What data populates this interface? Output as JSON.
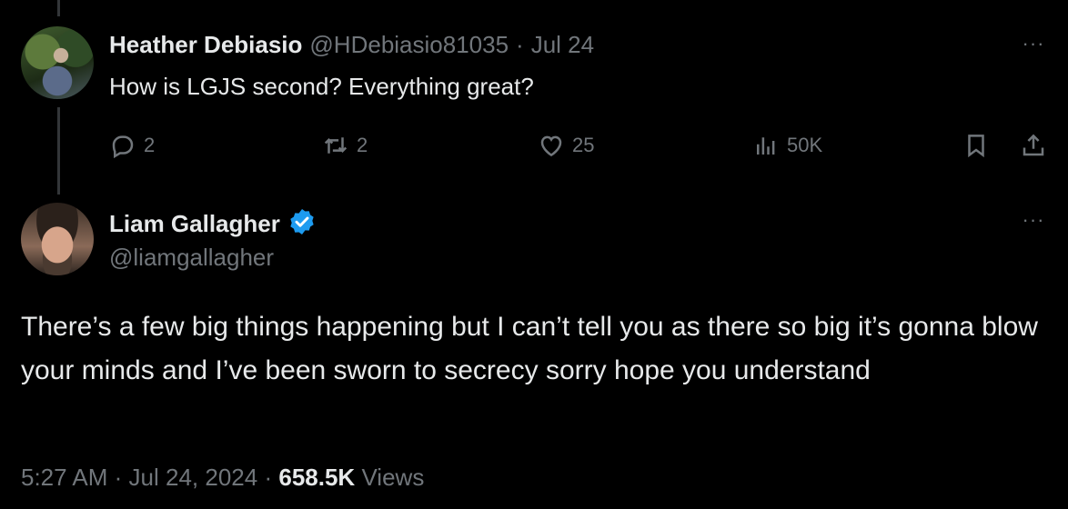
{
  "reply_tweet": {
    "display_name": "Heather Debiasio",
    "handle": "@HDebiasio81035",
    "separator": "·",
    "date": "Jul 24",
    "text": "How is LGJS second? Everything great?",
    "more": "···",
    "actions": {
      "replies": "2",
      "reposts": "2",
      "likes": "25",
      "views": "50K"
    }
  },
  "main_tweet": {
    "display_name": "Liam Gallagher",
    "handle": "@liamgallagher",
    "verified": true,
    "more": "···",
    "text": "There’s a few big things happening but I can’t tell you as there so big it’s gonna blow your minds and I’ve been sworn to secrecy sorry hope you understand",
    "time": "5:27 AM",
    "date": "Jul 24, 2024",
    "separator": "·",
    "views_count": "658.5K",
    "views_label": "Views"
  },
  "colors": {
    "background": "#000000",
    "text": "#e7e9ea",
    "muted": "#71767b",
    "verified": "#1d9bf0",
    "thread_line": "#333639"
  }
}
